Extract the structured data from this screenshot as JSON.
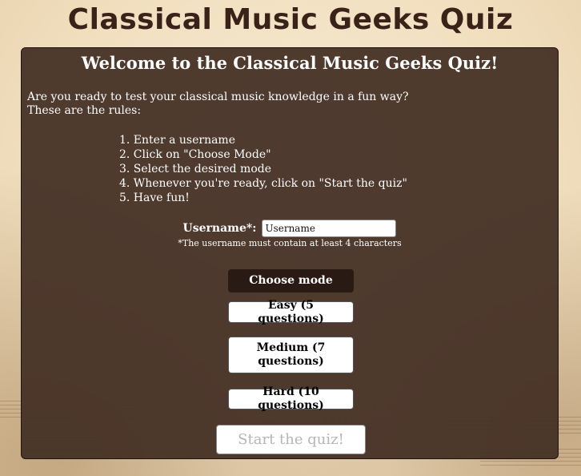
{
  "header": {
    "title": "Classical Music Geeks Quiz"
  },
  "panel": {
    "welcome": "Welcome to the Classical Music Geeks Quiz!",
    "intro_line1": "Are you ready to test your classical music knowledge in a fun way?",
    "intro_line2": "These are the rules:",
    "rules": [
      "1. Enter a username",
      "2. Click on \"Choose Mode\"",
      "3. Select the desired mode",
      "4. Whenever you're ready, click on \"Start the quiz\"",
      "5. Have fun!"
    ]
  },
  "username": {
    "label": "Username*:",
    "placeholder": "Username",
    "value": "",
    "hint": "*The username must contain at least 4 characters"
  },
  "buttons": {
    "choose_mode": "Choose mode",
    "easy": "Easy (5 questions)",
    "medium": "Medium (7 questions)",
    "hard": "Hard (10 questions)",
    "start": "Start the quiz!"
  },
  "colors": {
    "title": "#3a2218",
    "panel_bg": "#463026",
    "choose_mode_bg": "#2a1a14",
    "start_text_disabled": "#b5b5b5"
  },
  "decor": {
    "background_icon": "sheet-music-background"
  }
}
